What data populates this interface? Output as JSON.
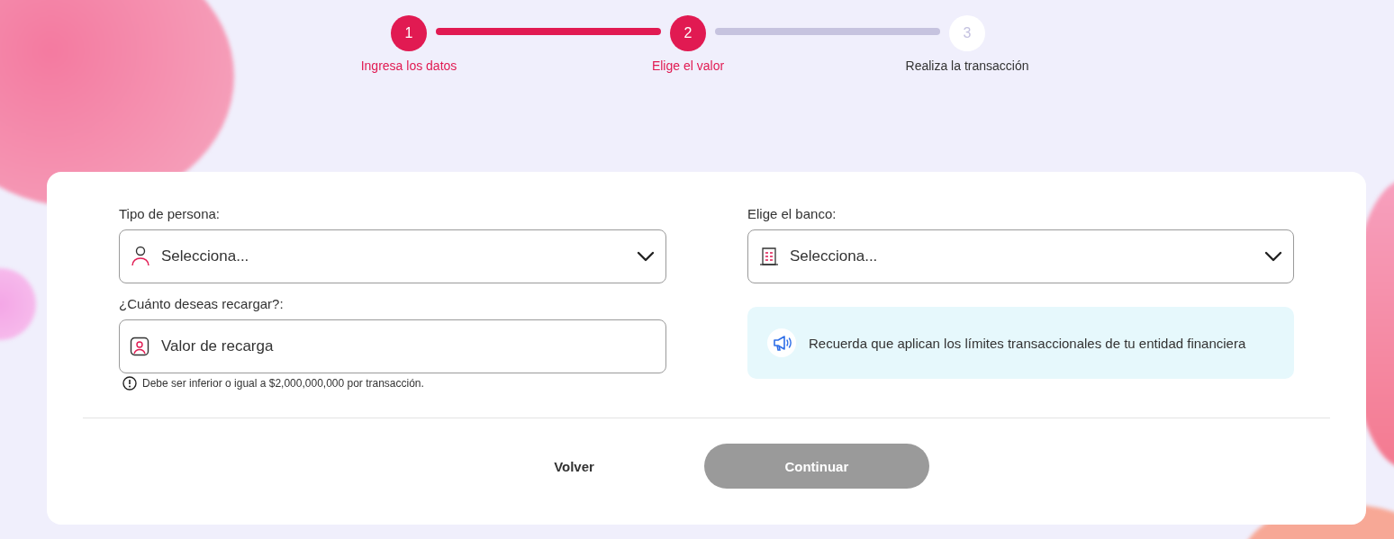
{
  "stepper": {
    "steps": [
      {
        "number": "1",
        "label": "Ingresa los datos",
        "active": true
      },
      {
        "number": "2",
        "label": "Elige el valor",
        "active": true
      },
      {
        "number": "3",
        "label": "Realiza la transacción",
        "active": false
      }
    ]
  },
  "form": {
    "left": [
      {
        "kind": "select",
        "label": "Tipo de persona:",
        "placeholder": "Selecciona..."
      },
      {
        "kind": "input",
        "label": "¿Cuánto deseas recargar?:",
        "placeholder": "Valor de recarga",
        "hint": "Debe ser inferior o igual a $2,000,000,000 por transacción."
      }
    ],
    "right": [
      {
        "kind": "select",
        "label": "Elige el banco:",
        "placeholder": "Selecciona..."
      },
      {
        "kind": "notice",
        "text": "Recuerda que aplican los límites transaccionales de tu entidad financiera"
      }
    ]
  },
  "actions": {
    "back": {
      "label": "Volver"
    },
    "continue": {
      "label": "Continuar",
      "disabled": true
    }
  }
}
